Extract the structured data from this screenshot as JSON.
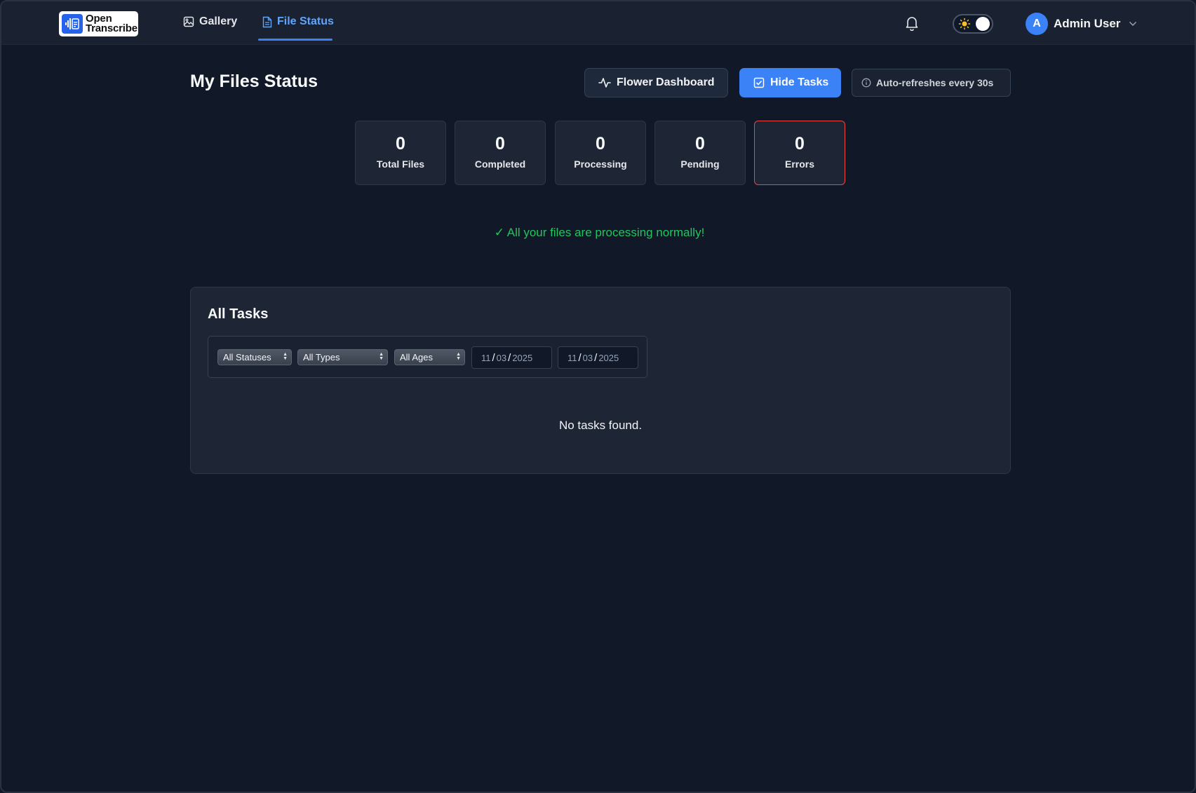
{
  "app": {
    "logo_line1": "Open",
    "logo_line2": "Transcribe"
  },
  "nav": {
    "gallery": "Gallery",
    "file_status": "File Status",
    "active": "File Status"
  },
  "user": {
    "initial": "A",
    "name": "Admin User"
  },
  "theme_toggle": {
    "mode": "dark"
  },
  "header": {
    "title": "My Files Status",
    "flower_button": "Flower Dashboard",
    "hide_tasks_button": "Hide Tasks",
    "auto_refresh": "Auto-refreshes every 30s"
  },
  "stats": [
    {
      "value": "0",
      "label": "Total Files"
    },
    {
      "value": "0",
      "label": "Completed"
    },
    {
      "value": "0",
      "label": "Processing"
    },
    {
      "value": "0",
      "label": "Pending"
    },
    {
      "value": "0",
      "label": "Errors"
    }
  ],
  "status_message": "✓ All your files are processing normally!",
  "tasks": {
    "title": "All Tasks",
    "filters": {
      "status": "All Statuses",
      "type": "All Types",
      "age": "All Ages",
      "date_from": {
        "month": "11",
        "day": "03",
        "year": "2025"
      },
      "date_to": {
        "month": "11",
        "day": "03",
        "year": "2025"
      }
    },
    "empty_message": "No tasks found."
  },
  "colors": {
    "background": "#111827",
    "accent": "#3b82f6",
    "success": "#22c55e",
    "error": "#ef4444"
  }
}
